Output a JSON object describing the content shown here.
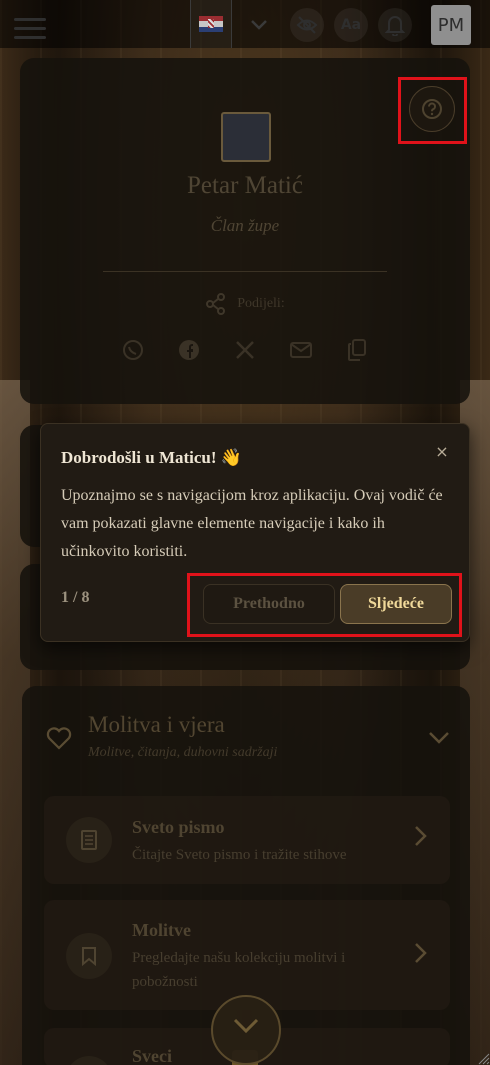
{
  "topbar": {
    "language_flag": "croatia-flag-icon",
    "font_size_label": "Aa",
    "avatar_initials": "PM"
  },
  "profile": {
    "name": "Petar Matić",
    "role": "Član župe",
    "share_label": "Podijeli:",
    "share_targets": [
      "whatsapp-icon",
      "facebook-icon",
      "x-icon",
      "mail-icon",
      "copy-icon"
    ]
  },
  "tour": {
    "title": "Dobrodošli u Maticu! 👋",
    "body": "Upoznajmo se s navigacijom kroz aplikaciju. Ovaj vodič će vam pokazati glavne elemente navigacije i kako ih učinkovito koristiti.",
    "step": "1 / 8",
    "prev_label": "Prethodno",
    "next_label": "Sljedeće",
    "close_label": "×"
  },
  "section": {
    "title": "Molitva i vjera",
    "subtitle": "Molitve, čitanja, duhovni sadržaji",
    "items": [
      {
        "title": "Sveto pismo",
        "desc": "Čitajte Sveto pismo i tražite stihove",
        "icon": "book-icon"
      },
      {
        "title": "Molitve",
        "desc": "Pregledajte našu kolekciju molitvi i pobožnosti",
        "icon": "bookmark-icon"
      },
      {
        "title": "Sveci",
        "desc": "",
        "icon": "saint-icon"
      }
    ]
  },
  "colors": {
    "highlight": "#e0121a",
    "accent_gold": "#f0d99a",
    "tooltip_bg": "#211b14"
  }
}
